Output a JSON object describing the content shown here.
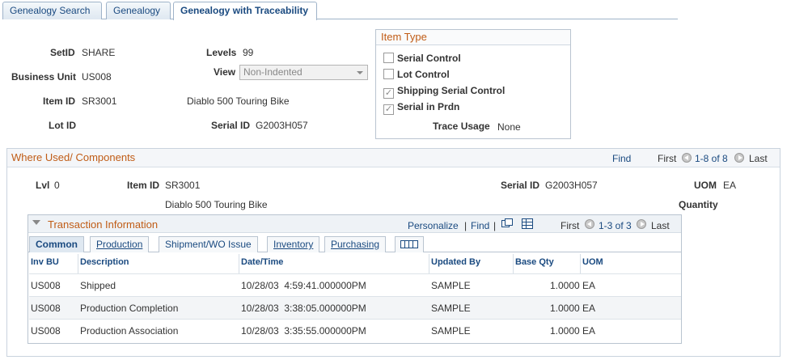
{
  "tabs": [
    {
      "label": "Genealogy Search"
    },
    {
      "label": "Genealogy"
    },
    {
      "label": "Genealogy with Traceability",
      "active": true
    }
  ],
  "header": {
    "setid_label": "SetID",
    "setid": "SHARE",
    "levels_label": "Levels",
    "levels": "99",
    "bu_label": "Business Unit",
    "bu": "US008",
    "view_label": "View",
    "view_value": "Non-Indented",
    "item_id_label": "Item ID",
    "item_id": "SR3001",
    "item_desc": "Diablo 500 Touring Bike",
    "lot_id_label": "Lot ID",
    "serial_id_label": "Serial ID",
    "serial_id": "G2003H057"
  },
  "item_type": {
    "title": "Item Type",
    "checkboxes": [
      {
        "label": "Serial Control",
        "checked": false
      },
      {
        "label": "Lot Control",
        "checked": false
      },
      {
        "label": "Shipping Serial Control",
        "checked": true
      },
      {
        "label": "Serial in Prdn",
        "checked": true
      }
    ],
    "trace_usage_label": "Trace Usage",
    "trace_usage": "None"
  },
  "where_used": {
    "title": "Where Used/ Components",
    "find": "Find",
    "first": "First",
    "range": "1-8 of 8",
    "last": "Last",
    "lvl_label": "Lvl",
    "lvl": "0",
    "item_id_label": "Item ID",
    "item_id": "SR3001",
    "item_desc": "Diablo 500 Touring Bike",
    "serial_id_label": "Serial ID",
    "serial_id": "G2003H057",
    "uom_label": "UOM",
    "uom": "EA",
    "quantity_label": "Quantity"
  },
  "transaction": {
    "title": "Transaction Information",
    "personalize": "Personalize",
    "separator": "|",
    "find": "Find",
    "first": "First",
    "range": "1-3 of 3",
    "last": "Last",
    "tabs": [
      {
        "label": "Common",
        "active": true
      },
      {
        "label": "Production"
      },
      {
        "label": "Shipment/WO Issue"
      },
      {
        "label": "Inventory"
      },
      {
        "label": "Purchasing"
      }
    ],
    "columns": [
      "Inv BU",
      "Description",
      "Date/Time",
      "Updated By",
      "Base Qty",
      "UOM"
    ],
    "rows": [
      [
        "US008",
        "Shipped",
        "10/28/03  4:59:41.000000PM",
        "SAMPLE",
        "1.0000",
        "EA"
      ],
      [
        "US008",
        "Production Completion",
        "10/28/03  3:38:05.000000PM",
        "SAMPLE",
        "1.0000",
        "EA"
      ],
      [
        "US008",
        "Production Association",
        "10/28/03  3:35:55.000000PM",
        "SAMPLE",
        "1.0000",
        "EA"
      ]
    ]
  }
}
